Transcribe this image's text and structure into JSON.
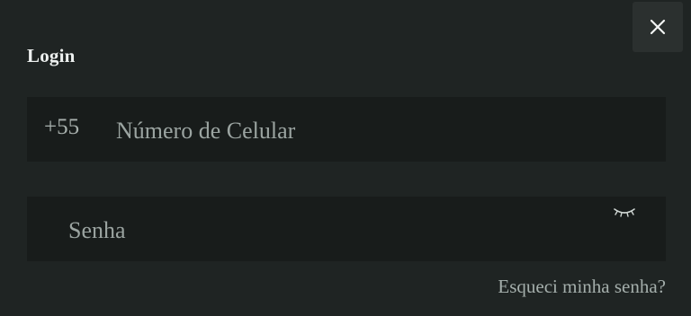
{
  "modal": {
    "title": "Login",
    "close_icon": "close-icon"
  },
  "phone_field": {
    "prefix": "+55",
    "placeholder": "Número de Celular",
    "value": ""
  },
  "password_field": {
    "placeholder": "Senha",
    "value": "",
    "toggle_icon": "eye-closed-icon"
  },
  "forgot_password": {
    "label": "Esqueci minha senha?"
  },
  "colors": {
    "background": "#1f2423",
    "field_background": "#181c1b",
    "close_button_background": "#2b302f",
    "title_text": "#eef1f0",
    "muted_text": "#a4aeab"
  }
}
